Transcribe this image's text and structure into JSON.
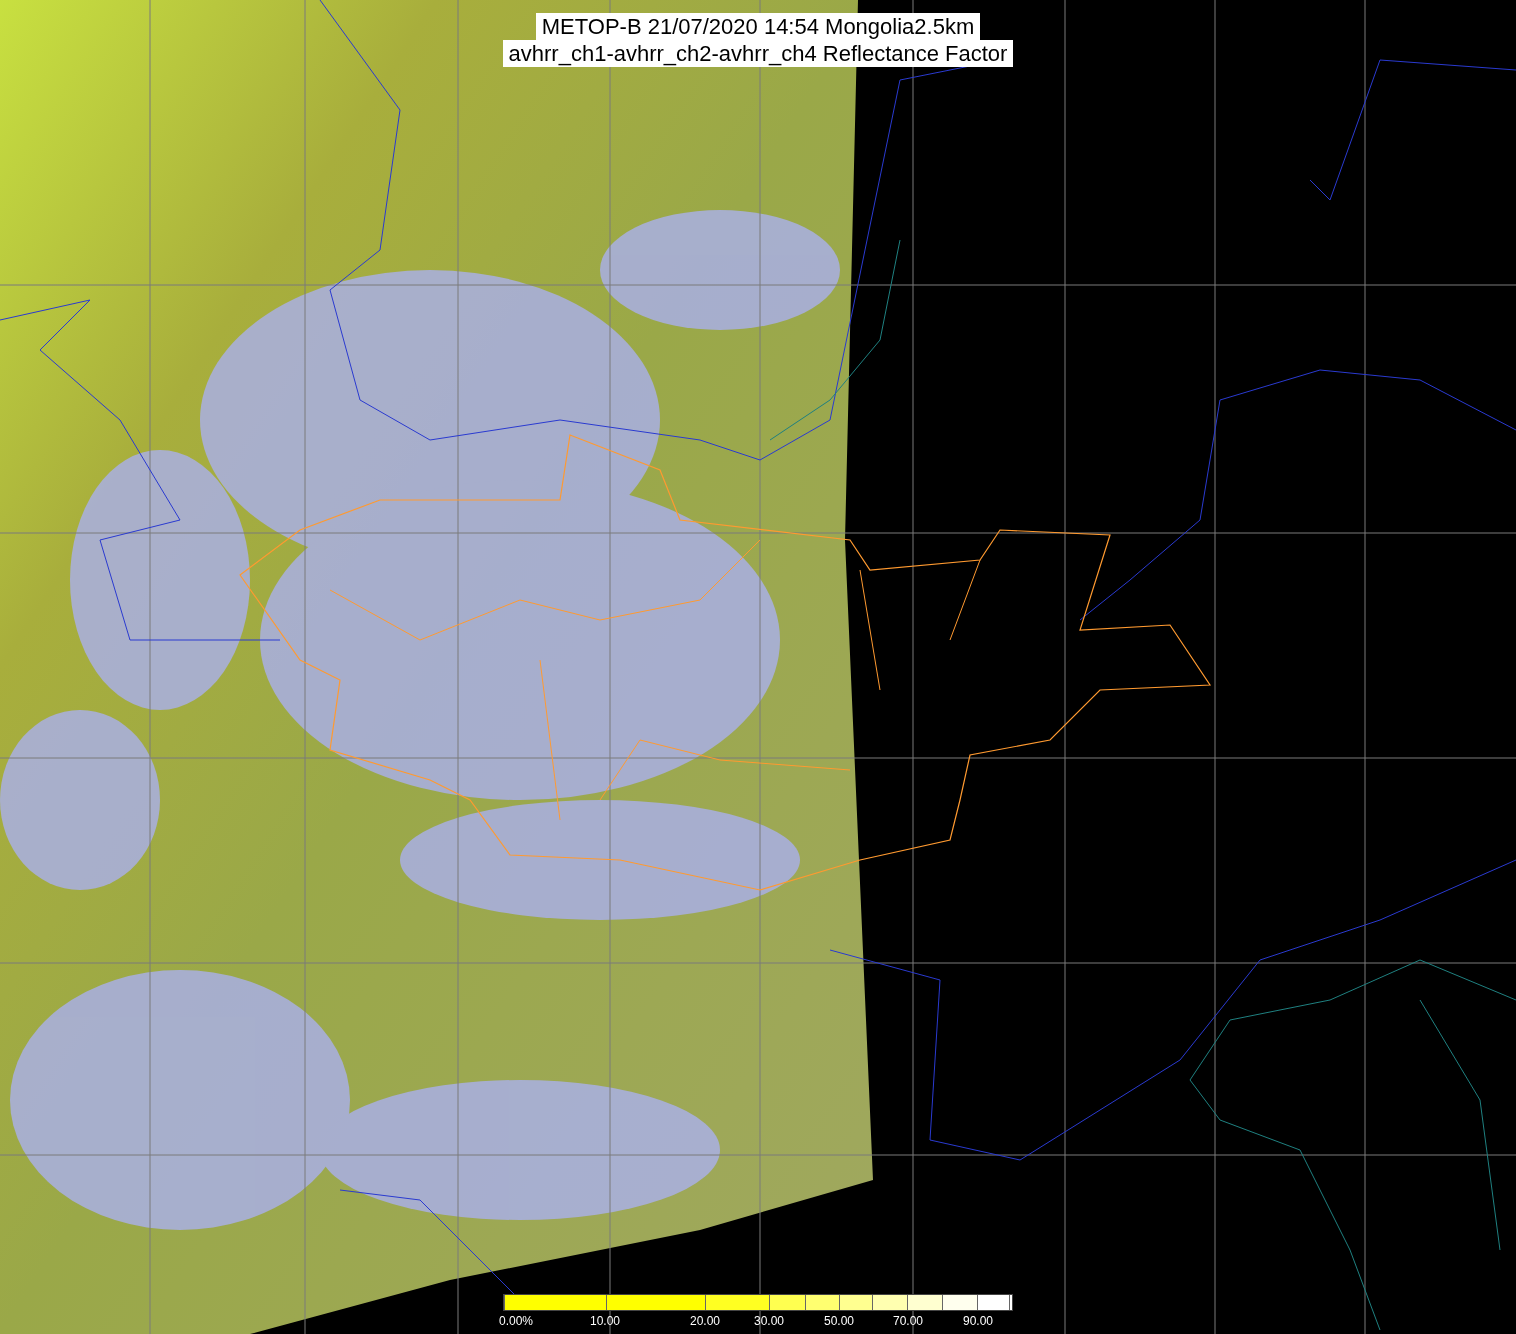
{
  "title_lines": [
    "METOP-B 21/07/2020 14:54 Mongolia2.5km",
    "avhrr_ch1-avhrr_ch2-avhrr_ch4 Reflectance Factor"
  ],
  "legend": {
    "segments": [
      {
        "color": "#ffff00",
        "label": "0.00%"
      },
      {
        "color": "#ffff00",
        "label": "10.00"
      },
      {
        "color": "#ffff22",
        "label": "20.00"
      },
      {
        "color": "#ffff50",
        "label": "30.00"
      },
      {
        "color": "#ffff70"
      },
      {
        "color": "#ffff90",
        "label": "50.00"
      },
      {
        "color": "#ffffb0"
      },
      {
        "color": "#ffffd0",
        "label": "70.00"
      },
      {
        "color": "#ffffee"
      },
      {
        "color": "#ffffff",
        "label": "90.00"
      },
      {
        "color": "#ffffff"
      }
    ]
  }
}
